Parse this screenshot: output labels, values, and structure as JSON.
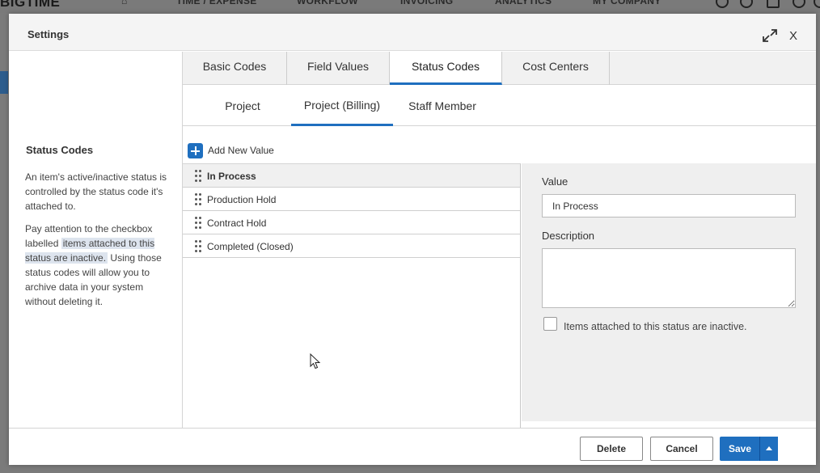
{
  "background": {
    "logo": "BIGTIME",
    "nav": [
      "TIME / EXPENSE",
      "WORKFLOW",
      "INVOICING",
      "ANALYTICS",
      "MY COMPANY"
    ]
  },
  "dialog": {
    "title": "Settings",
    "close_label": "X"
  },
  "sidebar": {
    "title": "Status Codes",
    "p1": "An item's active/inactive status is controlled by the status code it's attached to.",
    "p2_before": "Pay attention to the checkbox labelled ",
    "p2_highlight": "items attached to this status are inactive.",
    "p2_after": " Using those status codes will allow you to archive data in your system without deleting it."
  },
  "tabs": [
    "Basic Codes",
    "Field Values",
    "Status Codes",
    "Cost Centers"
  ],
  "active_tab": "Status Codes",
  "subtabs": [
    "Project",
    "Project (Billing)",
    "Staff Member"
  ],
  "active_subtab": "Project (Billing)",
  "add_new_label": "Add New Value",
  "status_list": [
    "In Process",
    "Production Hold",
    "Contract Hold",
    "Completed (Closed)"
  ],
  "selected_item": "In Process",
  "detail": {
    "value_label": "Value",
    "value": "In Process",
    "description_label": "Description",
    "description": "",
    "inactive_label": "Items attached to this status are inactive.",
    "inactive_checked": false
  },
  "footer": {
    "delete": "Delete",
    "cancel": "Cancel",
    "save": "Save"
  },
  "colors": {
    "accent": "#1f6fbf",
    "header_bg": "#f4f4f4",
    "detail_bg": "#efefef"
  }
}
